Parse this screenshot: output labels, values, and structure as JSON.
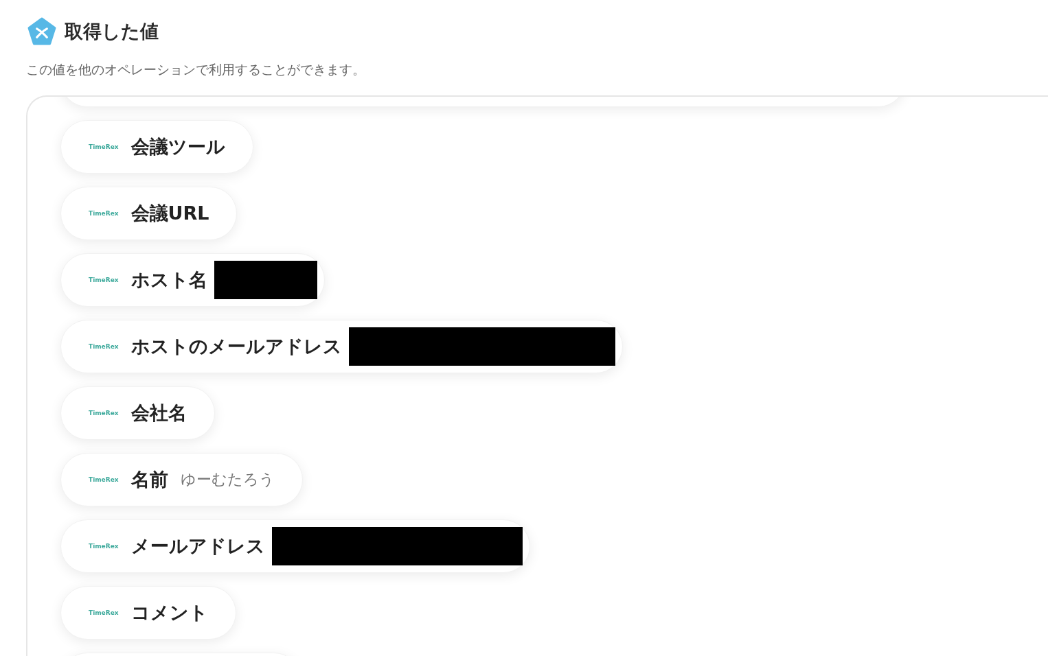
{
  "header": {
    "title": "取得した値",
    "description": "この値を他のオペレーションで利用することができます。"
  },
  "values": [
    {
      "source": "TimeRex",
      "label": "会議ツール",
      "redacted": false
    },
    {
      "source": "TimeRex",
      "label": "会議URL",
      "redacted": false
    },
    {
      "source": "TimeRex",
      "label": "ホスト名",
      "redacted": true
    },
    {
      "source": "TimeRex",
      "label": "ホストのメールアドレス",
      "redacted": true
    },
    {
      "source": "TimeRex",
      "label": "会社名",
      "redacted": false
    },
    {
      "source": "TimeRex",
      "label": "名前",
      "value": "ゆーむたろう",
      "redacted": false
    },
    {
      "source": "TimeRex",
      "label": "メールアドレス",
      "redacted": true
    },
    {
      "source": "TimeRex",
      "label": "コメント",
      "redacted": false
    }
  ]
}
